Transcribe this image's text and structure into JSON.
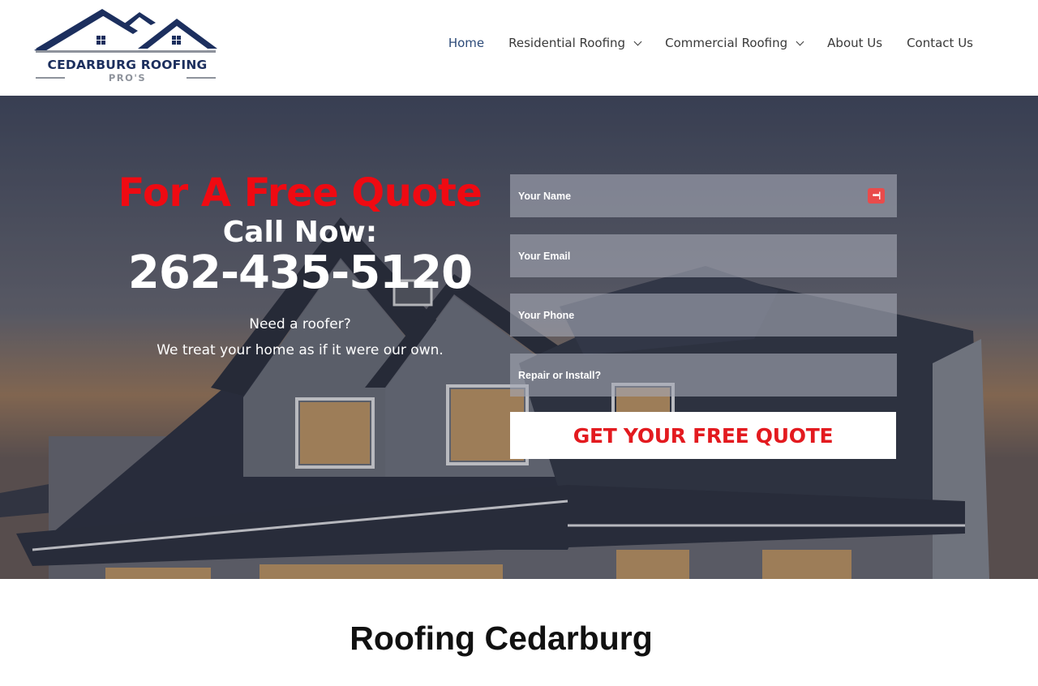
{
  "brand": {
    "name_line1": "CEDARBURG ROOFING",
    "name_line2": "PRO'S",
    "primary_color": "#1c2f5e",
    "accent_red": "#ef0a12"
  },
  "nav": {
    "items": [
      {
        "label": "Home",
        "active": true,
        "dropdown": false
      },
      {
        "label": "Residential Roofing",
        "active": false,
        "dropdown": true
      },
      {
        "label": "Commercial Roofing",
        "active": false,
        "dropdown": true
      },
      {
        "label": "About Us",
        "active": false,
        "dropdown": false
      },
      {
        "label": "Contact Us",
        "active": false,
        "dropdown": false
      }
    ]
  },
  "hero": {
    "headline": "For A Free Quote",
    "call_now": "Call Now:",
    "phone": "262-435-5120",
    "tagline1": "Need a roofer?",
    "tagline2": "We treat your home as if it were our own."
  },
  "form": {
    "fields": [
      {
        "placeholder": "Your Name",
        "value": ""
      },
      {
        "placeholder": "Your Email",
        "value": ""
      },
      {
        "placeholder": "Your Phone",
        "value": ""
      },
      {
        "placeholder": "Repair or Install?",
        "value": ""
      }
    ],
    "password_manager_icon": "•••|",
    "submit_label": "GET YOUR FREE QUOTE"
  },
  "section": {
    "title": "Roofing Cedarburg"
  }
}
